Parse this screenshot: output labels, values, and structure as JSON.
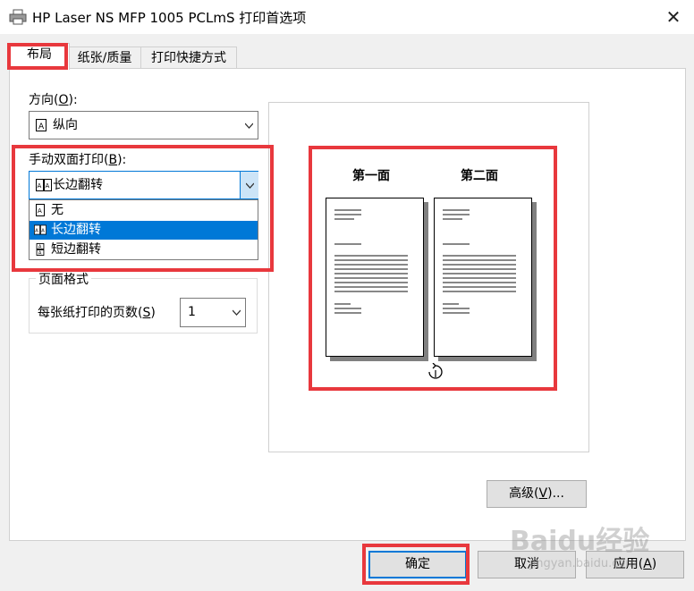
{
  "window": {
    "title": "HP Laser NS MFP 1005 PCLmS 打印首选项",
    "close_glyph": "✕"
  },
  "tabs": [
    {
      "label": "布局",
      "active": true
    },
    {
      "label": "纸张/质量",
      "active": false
    },
    {
      "label": "打印快捷方式",
      "active": false
    }
  ],
  "orientation": {
    "label_prefix": "方向(",
    "label_key": "O",
    "label_suffix": "):",
    "value": "纵向",
    "icon": "portrait-page-icon"
  },
  "duplex": {
    "label_prefix": "手动双面打印(",
    "label_key": "B",
    "label_suffix": "):",
    "value": "长边翻转",
    "icon": "long-edge-flip-icon",
    "options": [
      {
        "label": "无",
        "icon": "single-page-icon",
        "selected": false
      },
      {
        "label": "长边翻转",
        "icon": "long-edge-flip-icon",
        "selected": true
      },
      {
        "label": "短边翻转",
        "icon": "short-edge-flip-icon",
        "selected": false
      }
    ]
  },
  "page_format": {
    "group_title": "页面格式",
    "pages_per_sheet_prefix": "每张纸打印的页数(",
    "pages_per_sheet_key": "S",
    "pages_per_sheet_suffix": ")",
    "pages_per_sheet_value": "1"
  },
  "preview": {
    "front_label": "第一面",
    "back_label": "第二面",
    "flip_icon": "rotate-flip-icon"
  },
  "buttons": {
    "advanced_prefix": "高级(",
    "advanced_key": "V",
    "advanced_suffix": ")...",
    "ok": "确定",
    "cancel": "取消",
    "apply_prefix": "应用(",
    "apply_key": "A",
    "apply_suffix": ")"
  },
  "watermark": {
    "text": "Baidu经验",
    "sub": "jingyan.baidu.com"
  },
  "colors": {
    "highlight": "#e8383d",
    "selection": "#0078d7"
  }
}
